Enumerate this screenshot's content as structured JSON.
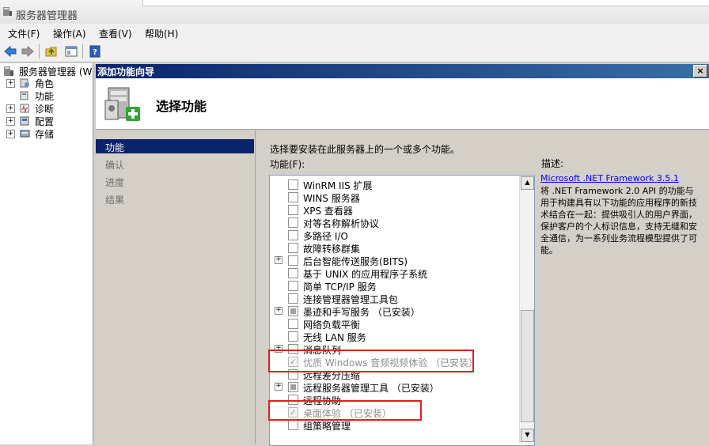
{
  "window": {
    "title": "服务器管理器"
  },
  "menu": [
    "文件(F)",
    "操作(A)",
    "查看(V)",
    "帮助(H)"
  ],
  "toolbar": {
    "icons": [
      "back-arrow-icon",
      "forward-arrow-icon",
      "up-folder-icon",
      "show-hide-tree-icon",
      "help-icon"
    ]
  },
  "tree": {
    "root": "服务器管理器 (W",
    "items": [
      {
        "label": "角色",
        "expander": "+"
      },
      {
        "label": "功能",
        "expander": ""
      },
      {
        "label": "诊断",
        "expander": "+"
      },
      {
        "label": "配置",
        "expander": "+"
      },
      {
        "label": "存储",
        "expander": "+"
      }
    ]
  },
  "wizard": {
    "title": "添加功能向导",
    "close": "×",
    "heading": "选择功能",
    "steps": [
      "功能",
      "确认",
      "进度",
      "结果"
    ],
    "instruction": "选择要安装在此服务器上的一个或多个功能。",
    "features_label": "功能(F):",
    "description_label": "描述:",
    "description_link": "Microsoft .NET Framework 3.5.1",
    "description_text": "将 .NET Framework 2.0 API 的功能与用于构建具有以下功能的应用程序的新技术结合在一起：提供吸引人的用户界面，保护客户的个人标识信息，支持无缝和安全通信，为一系列业务流程模型提供了可能。",
    "features": [
      {
        "label": "WinRM IIS 扩展",
        "expander": "",
        "state": "unchecked"
      },
      {
        "label": "WINS 服务器",
        "expander": "",
        "state": "unchecked"
      },
      {
        "label": "XPS 查看器",
        "expander": "",
        "state": "unchecked"
      },
      {
        "label": "对等名称解析协议",
        "expander": "",
        "state": "unchecked"
      },
      {
        "label": "多路径 I/O",
        "expander": "",
        "state": "unchecked"
      },
      {
        "label": "故障转移群集",
        "expander": "",
        "state": "unchecked"
      },
      {
        "label": "后台智能传送服务(BITS)",
        "expander": "+",
        "state": "unchecked"
      },
      {
        "label": "基于 UNIX 的应用程序子系统",
        "expander": "",
        "state": "unchecked"
      },
      {
        "label": "简单 TCP/IP 服务",
        "expander": "",
        "state": "unchecked"
      },
      {
        "label": "连接管理器管理工具包",
        "expander": "",
        "state": "unchecked"
      },
      {
        "label": "墨迹和手写服务  （已安装）",
        "expander": "+",
        "state": "partial"
      },
      {
        "label": "网络负载平衡",
        "expander": "",
        "state": "unchecked"
      },
      {
        "label": "无线 LAN 服务",
        "expander": "",
        "state": "unchecked"
      },
      {
        "label": "消息队列",
        "expander": "+",
        "state": "unchecked"
      },
      {
        "label": "优质 Windows 音频视频体验  （已安装）",
        "expander": "",
        "state": "installed-checked"
      },
      {
        "label": "远程差分压缩",
        "expander": "",
        "state": "unchecked"
      },
      {
        "label": "远程服务器管理工具  （已安装）",
        "expander": "+",
        "state": "partial"
      },
      {
        "label": "远程协助",
        "expander": "",
        "state": "unchecked"
      },
      {
        "label": "桌面体验  （已安装）",
        "expander": "",
        "state": "installed-checked"
      },
      {
        "label": "组策略管理",
        "expander": "",
        "state": "unchecked"
      }
    ]
  },
  "colors": {
    "highlight": "#e02020",
    "selection": "#0a246a",
    "link": "#0000ff"
  }
}
